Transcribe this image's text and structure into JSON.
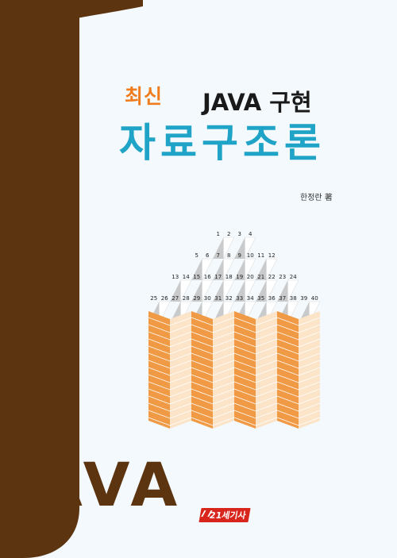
{
  "cover": {
    "kicker_new": "최신",
    "kicker_java": "JAVA 구현",
    "title": "자료구조론",
    "author": "한정란 著",
    "java_word": "AVA",
    "publisher": "21세기사"
  },
  "diagram": {
    "cells": [
      "1",
      "2",
      "3",
      "4",
      "5",
      "6",
      "7",
      "8",
      "9",
      "10",
      "11",
      "12",
      "13",
      "14",
      "15",
      "16",
      "17",
      "18",
      "19",
      "20",
      "21",
      "22",
      "23",
      "24",
      "25",
      "26",
      "27",
      "28",
      "29",
      "30",
      "31",
      "32",
      "33",
      "34",
      "35",
      "36",
      "37",
      "38",
      "39",
      "40"
    ]
  },
  "colors": {
    "background": "#f3f9fd",
    "j_brown": "#5c3510",
    "accent_orange": "#f07c1e",
    "title_cyan": "#1fa3c6",
    "publisher_red": "#d8261c"
  }
}
